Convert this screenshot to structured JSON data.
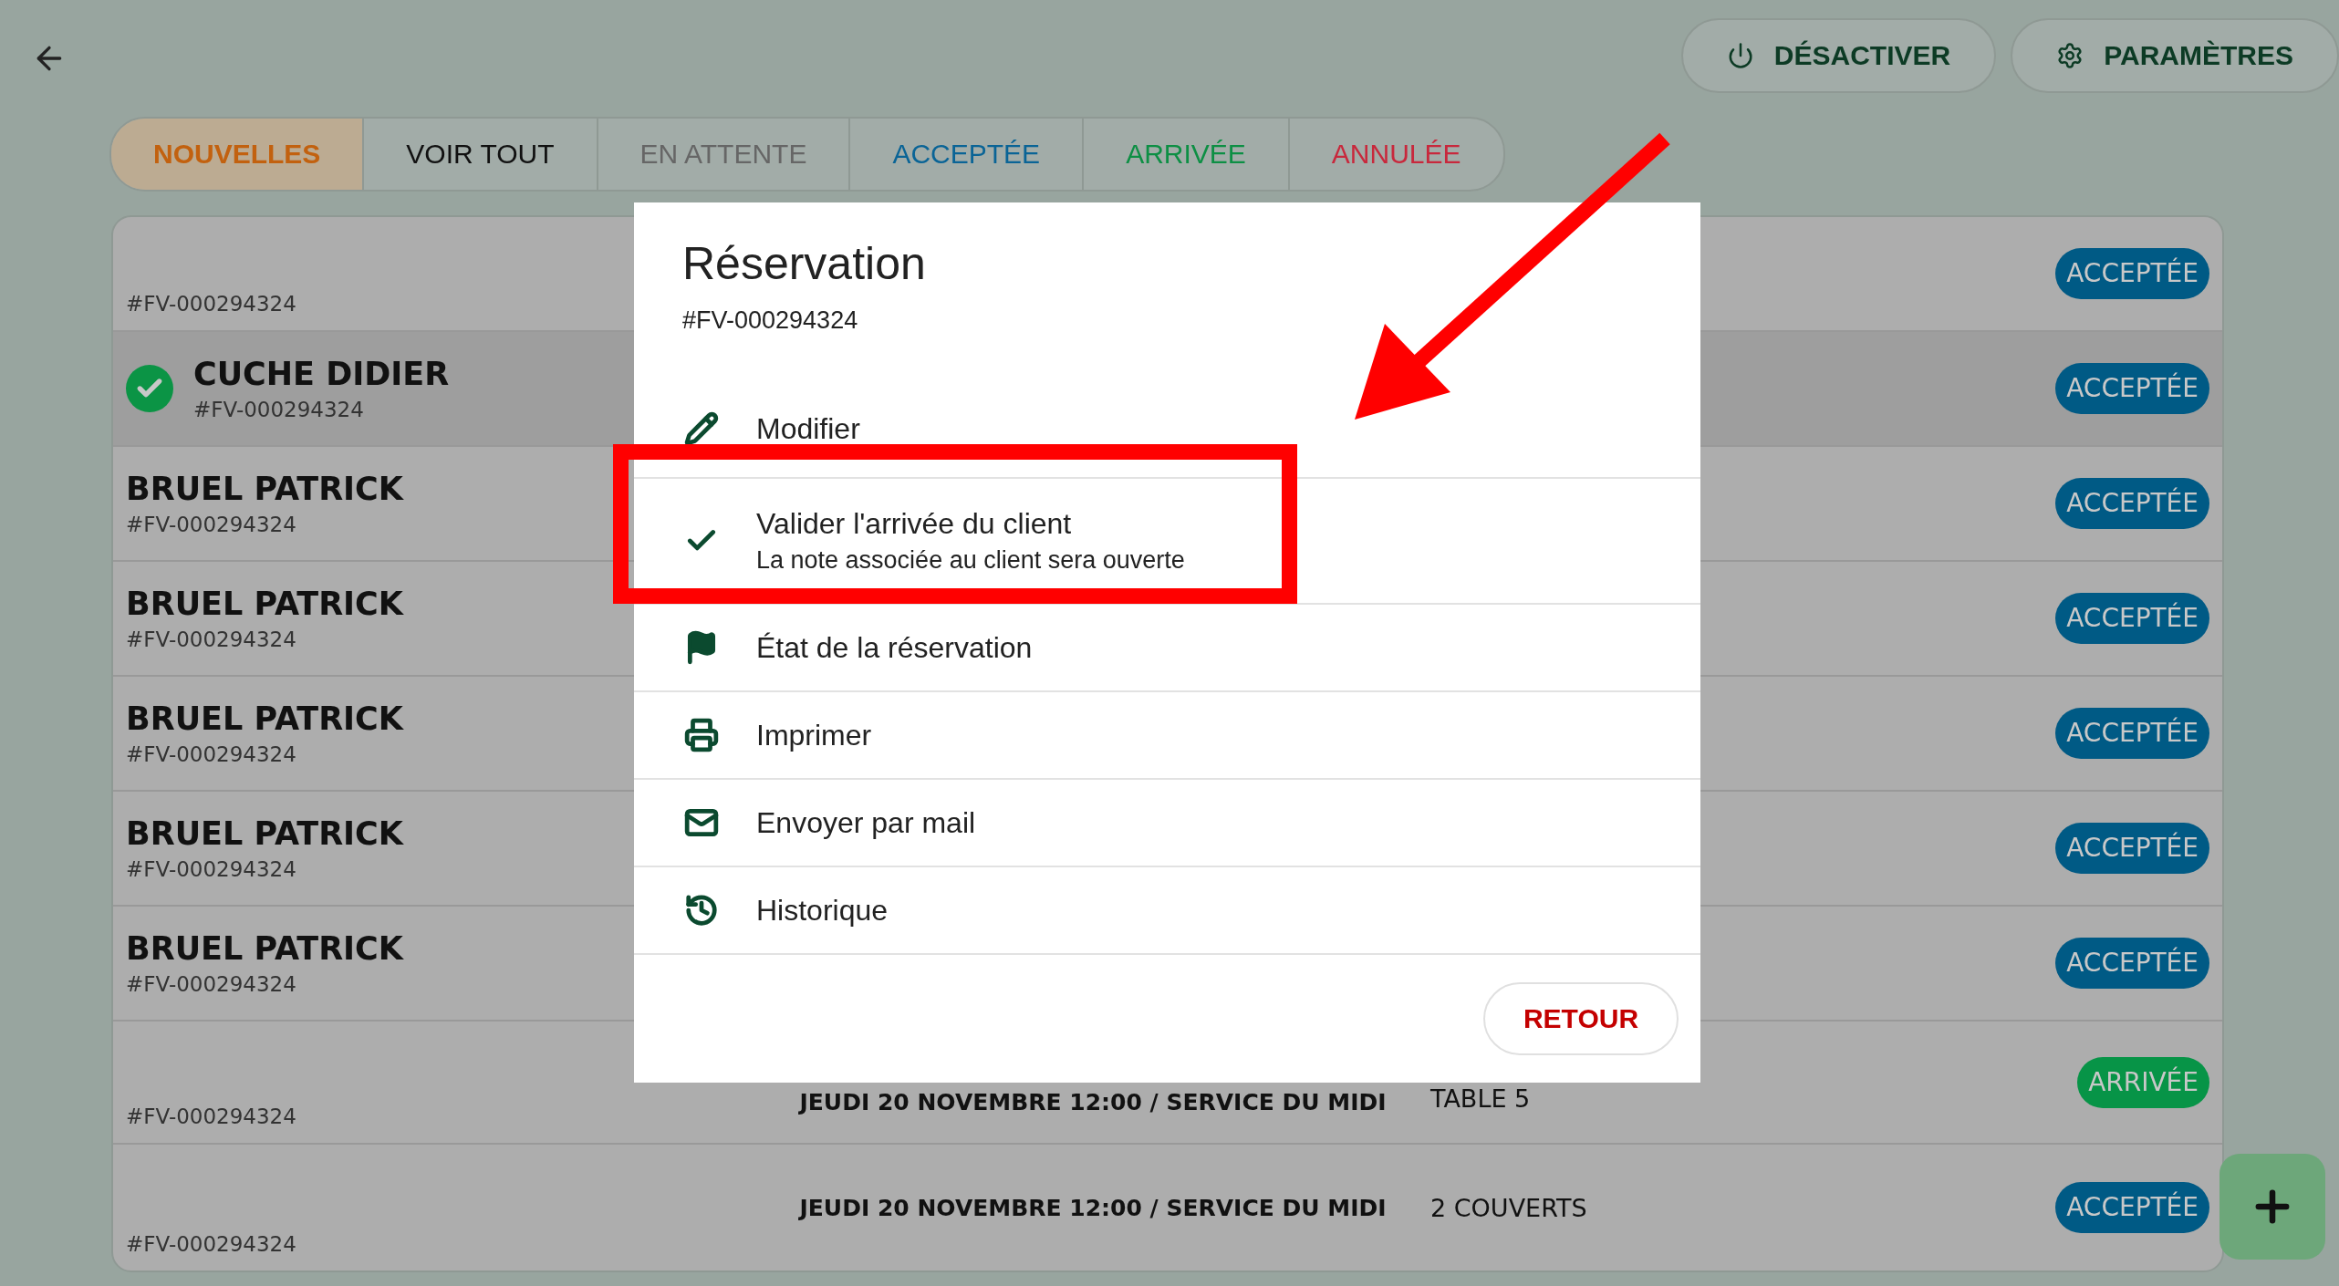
{
  "header": {
    "buttons": [
      {
        "label": "DÉSACTIVER",
        "kind": "power"
      },
      {
        "label": "PARAMÈTRES",
        "kind": "settings"
      }
    ]
  },
  "tabs": [
    {
      "label": "NOUVELLES",
      "selected": true,
      "color": "#c2610f"
    },
    {
      "label": "VOIR TOUT",
      "selected": false,
      "color": "#111111"
    },
    {
      "label": "EN ATTENTE",
      "selected": false,
      "color": "#666666"
    },
    {
      "label": "ACCEPTÉE",
      "selected": false,
      "color": "#0a6496"
    },
    {
      "label": "ARRIVÉE",
      "selected": false,
      "color": "#0d8f44"
    },
    {
      "label": "ANNULÉE",
      "selected": false,
      "color": "#c8283c"
    }
  ],
  "reservations": [
    {
      "ref": "#FV-000294324",
      "status": "ACCEPTÉE",
      "color": "#005a85",
      "selected": false
    },
    {
      "name": "CUCHE DIDIER",
      "ref": "#FV-000294324",
      "status": "ACCEPTÉE",
      "color": "#005a85",
      "selected": true,
      "checked": true
    },
    {
      "name": "BRUEL PATRICK",
      "ref": "#FV-000294324",
      "status": "ACCEPTÉE",
      "color": "#005a85",
      "selected": false
    },
    {
      "name": "BRUEL PATRICK",
      "ref": "#FV-000294324",
      "status": "ACCEPTÉE",
      "color": "#005a85",
      "selected": false
    },
    {
      "name": "BRUEL PATRICK",
      "ref": "#FV-000294324",
      "status": "ACCEPTÉE",
      "color": "#005a85",
      "selected": false
    },
    {
      "name": "BRUEL PATRICK",
      "ref": "#FV-000294324",
      "status": "ACCEPTÉE",
      "color": "#005a85",
      "selected": false
    },
    {
      "name": "BRUEL PATRICK",
      "ref": "#FV-000294324",
      "status": "ACCEPTÉE",
      "color": "#005a85",
      "selected": false
    },
    {
      "ref": "#FV-000294324",
      "date": "JEUDI 20 NOVEMBRE 12:00 / SERVICE DU MIDI",
      "info": "TABLE 5",
      "status": "ARRIVÉE",
      "color": "#079447",
      "selected": false
    },
    {
      "ref": "#FV-000294324",
      "date": "JEUDI 20 NOVEMBRE 12:00 / SERVICE DU MIDI",
      "info": "2 COUVERTS",
      "status": "ACCEPTÉE",
      "color": "#005a85",
      "selected": false
    }
  ],
  "dialog": {
    "title": "Réservation",
    "ref": "#FV-000294324",
    "items": [
      {
        "kind": "edit",
        "label": "Modifier"
      },
      {
        "kind": "check",
        "label": "Valider l'arrivée du client",
        "subtitle": "La note associée au client sera ouverte"
      },
      {
        "kind": "flag",
        "label": "État de la réservation"
      },
      {
        "kind": "print",
        "label": "Imprimer"
      },
      {
        "kind": "mail",
        "label": "Envoyer par mail"
      },
      {
        "kind": "history",
        "label": "Historique"
      }
    ],
    "button": "RETOUR"
  }
}
